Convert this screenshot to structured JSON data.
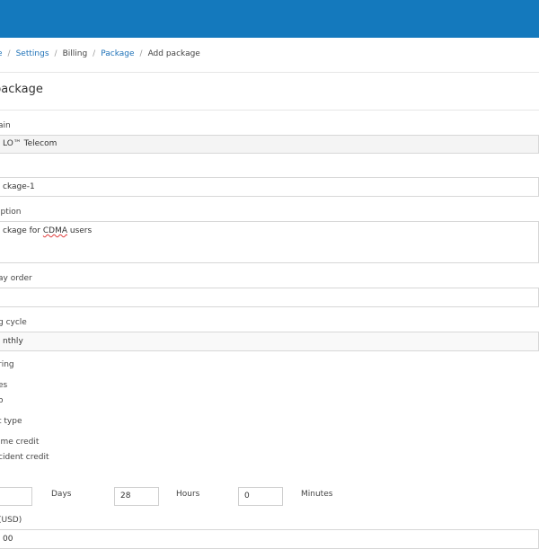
{
  "breadcrumb": {
    "home": "e",
    "settings": "Settings",
    "billing": "Billing",
    "package": "Package",
    "current": "Add package",
    "separator": "/"
  },
  "page": {
    "title": " package"
  },
  "form": {
    "domain": {
      "label": "ain",
      "value": "LO™ Telecom"
    },
    "name": {
      "value": "ckage-1"
    },
    "description": {
      "label": "iption",
      "value_prefix": "ckage for ",
      "value_marked": "CDMA",
      "value_suffix": " users"
    },
    "display_order": {
      "label": "ay order",
      "value": ""
    },
    "billing_cycle": {
      "label": "g cycle",
      "value": "nthly"
    },
    "recurring": {
      "label": "ring",
      "option_yes": "es",
      "option_no": "o"
    },
    "credit_type": {
      "label": "t type",
      "option_one_time": "ime credit",
      "option_incident": "cident credit"
    },
    "duration": {
      "days_value": "",
      "days_label": "Days",
      "hours_value": "28",
      "hours_label": "Hours",
      "minutes_value": "0",
      "minutes_label": "Minutes"
    },
    "price": {
      "label": "(USD)",
      "value": "00"
    }
  },
  "colors": {
    "topbar": "#1479bd",
    "link": "#1f72b8"
  }
}
